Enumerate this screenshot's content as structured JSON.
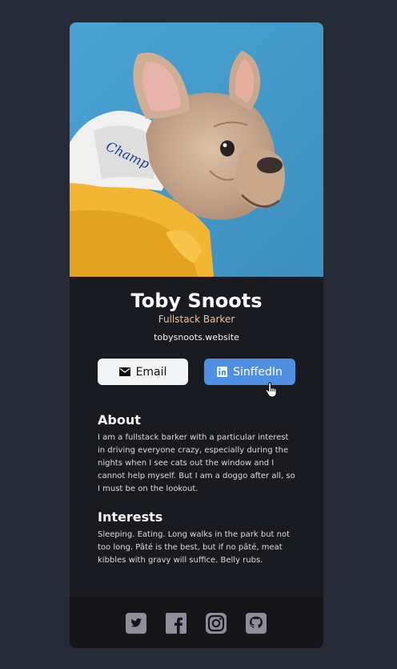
{
  "profile": {
    "name": "Toby Snoots",
    "role": "Fullstack Barker",
    "website": "tobysnoots.website",
    "photo_icon": "french-bulldog-photo"
  },
  "buttons": {
    "email_label": "Email",
    "email_icon": "envelope-icon",
    "linkedin_label": "SinffedIn",
    "linkedin_icon": "linkedin-icon"
  },
  "about": {
    "title": "About",
    "body": "I am a fullstack barker with a particular interest in driving everyone crazy, especially during the nights when I see cats out the window and I cannot help myself. But I am a doggo after all, so I must be on the lookout."
  },
  "interests": {
    "title": "Interests",
    "body": "Sleeping. Eating. Long walks in the park but not too long. Pâté is the best, but if no pâté, meat kibbles with gravy will suffice. Belly rubs."
  },
  "footer": {
    "icons": [
      "twitter-icon",
      "facebook-icon",
      "instagram-icon",
      "github-icon"
    ]
  },
  "colors": {
    "page_bg": "#272a37",
    "card_bg": "#1a1b21",
    "footer_bg": "#161619",
    "accent_role": "#f3bf99",
    "linkedin_button": "#4f90e3",
    "email_button": "#f3f4f6",
    "social_icon": "#918e9b"
  }
}
